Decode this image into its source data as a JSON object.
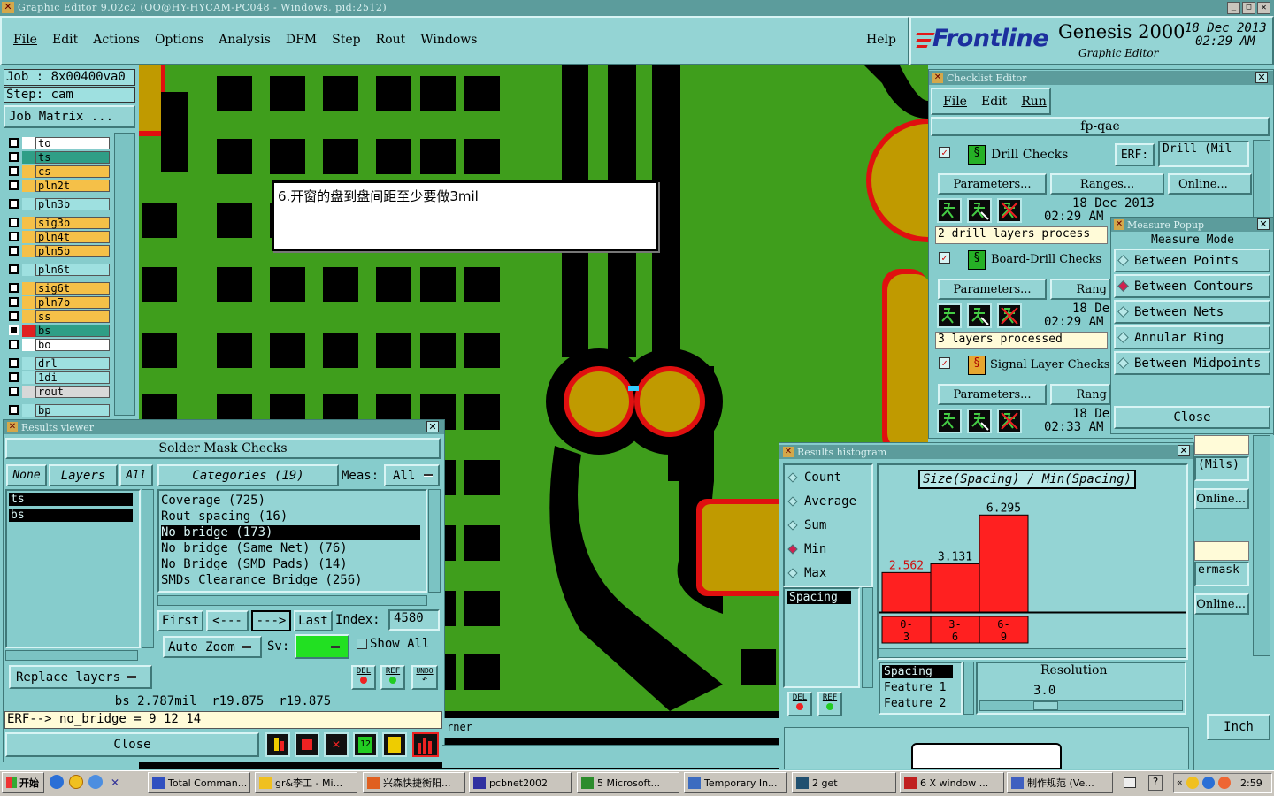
{
  "window": {
    "title": "Graphic Editor 9.02c2 (OO@HY-HYCAM-PC048 - Windows, pid:2512)"
  },
  "menu": [
    "File",
    "Edit",
    "Actions",
    "Options",
    "Analysis",
    "DFM",
    "Step",
    "Rout",
    "Windows"
  ],
  "help": "Help",
  "brand": {
    "logo": "Frontline",
    "product": "Genesis 2000",
    "subtitle": "Graphic Editor",
    "date": "18 Dec 2013",
    "time": "02:29 AM"
  },
  "job": {
    "job_label": "Job : 8x00400va0",
    "step_label": "Step: cam",
    "matrix_btn": "Job Matrix ..."
  },
  "layers": [
    {
      "name": "to",
      "color": "#ffffff",
      "marker": "#ffffff"
    },
    {
      "name": "ts",
      "color": "#2f9e86",
      "marker": "#2f9e86"
    },
    {
      "name": "cs",
      "color": "#f5c048",
      "marker": "#f5c048"
    },
    {
      "name": "pln2t",
      "color": "#f5c048",
      "marker": "#f5c048"
    },
    {
      "name": "pln3b",
      "color": "#9ee0e0",
      "marker": "#9ee0e0"
    },
    {
      "name": "sig3b",
      "color": "#f5c048",
      "marker": "#f5c048"
    },
    {
      "name": "pln4t",
      "color": "#f5c048",
      "marker": "#f5c048"
    },
    {
      "name": "pln5b",
      "color": "#f5c048",
      "marker": "#f5c048"
    },
    {
      "name": "pln6t",
      "color": "#9ee0e0",
      "marker": "#9ee0e0"
    },
    {
      "name": "sig6t",
      "color": "#f5c048",
      "marker": "#f5c048"
    },
    {
      "name": "pln7b",
      "color": "#f5c048",
      "marker": "#f5c048"
    },
    {
      "name": "ss",
      "color": "#f5c048",
      "marker": "#f5c048"
    },
    {
      "name": "bs",
      "color": "#2f9e86",
      "marker": "#e02020"
    },
    {
      "name": "bo",
      "color": "#ffffff",
      "marker": "#ffffff"
    },
    {
      "name": "drl",
      "color": "#9ee0e0",
      "marker": "#9ee0e0"
    },
    {
      "name": "1di",
      "color": "#9ee0e0",
      "marker": "#9ee0e0"
    },
    {
      "name": "rout",
      "color": "#d8d8d8",
      "marker": "#d8d8d8"
    },
    {
      "name": "bp",
      "color": "#9ee0e0",
      "marker": "#9ee0e0"
    }
  ],
  "annotation": "6.开窗的盘到盘间距至少要做3mil",
  "checklist": {
    "title": "Checklist Editor",
    "menu": [
      "File",
      "Edit",
      "Run"
    ],
    "name": "fp-qae",
    "erf_label": "ERF:",
    "erf_value": "Drill (Mil",
    "checks": [
      {
        "name": "Drill Checks",
        "params": "Parameters...",
        "ranges": "Ranges...",
        "online": "Online...",
        "date": "18 Dec 2013",
        "time": "02:29 AM",
        "status": "2 drill layers process"
      },
      {
        "name": "Board-Drill Checks",
        "params": "Parameters...",
        "ranges": "Rang",
        "date": "18 De",
        "time": "02:29 AM",
        "status": "3 layers processed"
      },
      {
        "name": "Signal Layer Checks",
        "params": "Parameters...",
        "ranges": "Rang",
        "date": "18 De",
        "time": "02:33 AM"
      }
    ],
    "right_fragments": [
      "(Mils)",
      "Online...",
      "ermask",
      "Online..."
    ],
    "inch_btn": "Inch"
  },
  "measure": {
    "title": "Measure Popup",
    "mode_label": "Measure Mode",
    "modes": [
      "Between Points",
      "Between Contours",
      "Between Nets",
      "Annular Ring",
      "Between Midpoints"
    ],
    "selected": "Between Contours",
    "close": "Close"
  },
  "results_viewer": {
    "title": "Results viewer",
    "header": "Solder Mask Checks",
    "none_btn": "None",
    "layers_btn": "Layers",
    "all_btn": "All",
    "categories_btn": "Categories (19)",
    "meas_label": "Meas:",
    "meas_value": "All",
    "layer_list": [
      "ts",
      "bs"
    ],
    "categories": [
      "Coverage (725)",
      "Rout spacing (16)",
      "No bridge (173)",
      "No bridge (Same Net) (76)",
      "No Bridge (SMD Pads) (14)",
      "SMDs Clearance Bridge (256)"
    ],
    "selected_category": "No bridge (173)",
    "first": "First",
    "prev": "<---",
    "next": "--->",
    "last": "Last",
    "index_label": "Index:",
    "index_value": "4580",
    "auto_zoom": "Auto Zoom",
    "sv_label": "Sv:",
    "show_all": "Show All",
    "replace_layers": "Replace layers",
    "del": "DEL",
    "ref": "REF",
    "undo": "UNDO",
    "status": "bs 2.787mil  r19.875  r19.875",
    "erf_line": "ERF--> no_bridge = 9 12 14",
    "close": "Close",
    "behind_text": "rner"
  },
  "histogram": {
    "title": "Results histogram",
    "options": [
      "Count",
      "Average",
      "Sum",
      "Min",
      "Max"
    ],
    "selected": "Min",
    "chart_title": "Size(Spacing) / Min(Spacing)",
    "list_items": [
      "Spacing"
    ],
    "feature_list": [
      "Spacing",
      "Feature 1",
      "Feature 2"
    ],
    "resolution_label": "Resolution",
    "resolution_value": "3.0",
    "del": "DEL",
    "ref": "REF"
  },
  "chart_data": {
    "type": "bar",
    "title": "Size(Spacing) / Min(Spacing)",
    "categories": [
      "0-3",
      "3-6",
      "6-9"
    ],
    "values": [
      2.562,
      3.131,
      6.295
    ],
    "labels": [
      "2.562",
      "3.131",
      "6.295"
    ],
    "ylim": [
      0,
      7
    ],
    "bar_color": "#ff2020",
    "grid": false
  },
  "taskbar": {
    "start": "开始",
    "items": [
      "Total Comman...",
      "gr&李工 - Mi...",
      "兴森快捷衡阳...",
      "pcbnet2002",
      "5 Microsoft...",
      "Temporary In...",
      "2 get",
      "6 X window ...",
      "制作规范 (Ve..."
    ],
    "clock": "2:59"
  }
}
